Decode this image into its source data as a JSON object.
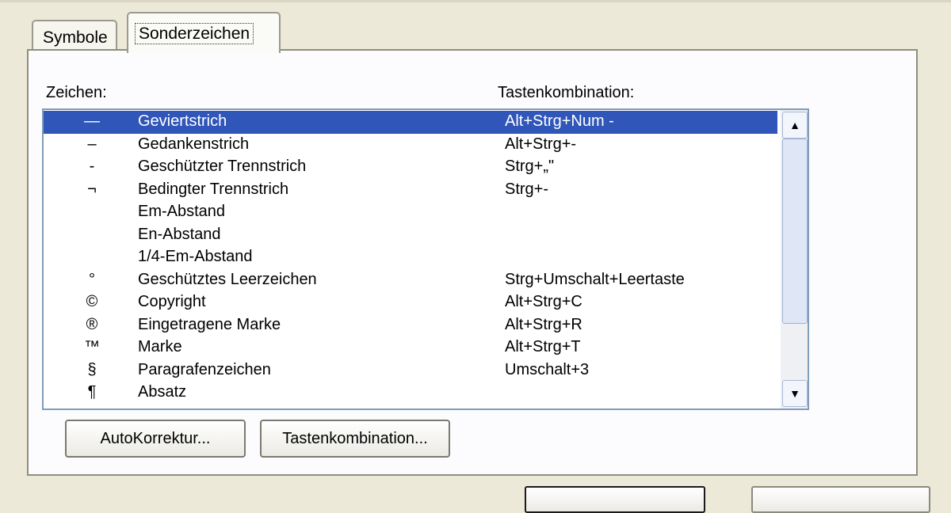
{
  "tabs": [
    {
      "label": "Symbole",
      "active": false
    },
    {
      "label": "Sonderzeichen",
      "active": true
    }
  ],
  "columns": {
    "characters": "Zeichen:",
    "shortcut": "Tastenkombination:"
  },
  "rows": [
    {
      "symbol": "—",
      "name": "Geviertstrich",
      "shortcut": "Alt+Strg+Num -",
      "selected": true
    },
    {
      "symbol": "–",
      "name": "Gedankenstrich",
      "shortcut": "Alt+Strg+-"
    },
    {
      "symbol": "-",
      "name": "Geschützter Trennstrich",
      "shortcut": "Strg+„\""
    },
    {
      "symbol": "¬",
      "name": "Bedingter Trennstrich",
      "shortcut": "Strg+-"
    },
    {
      "symbol": "",
      "name": "Em-Abstand",
      "shortcut": ""
    },
    {
      "symbol": "",
      "name": "En-Abstand",
      "shortcut": ""
    },
    {
      "symbol": "",
      "name": "1/4-Em-Abstand",
      "shortcut": ""
    },
    {
      "symbol": "°",
      "name": "Geschütztes Leerzeichen",
      "shortcut": "Strg+Umschalt+Leertaste"
    },
    {
      "symbol": "©",
      "name": "Copyright",
      "shortcut": "Alt+Strg+C"
    },
    {
      "symbol": "®",
      "name": "Eingetragene Marke",
      "shortcut": "Alt+Strg+R"
    },
    {
      "symbol": "™",
      "name": "Marke",
      "shortcut": "Alt+Strg+T"
    },
    {
      "symbol": "§",
      "name": "Paragrafenzeichen",
      "shortcut": "Umschalt+3"
    },
    {
      "symbol": "¶",
      "name": "Absatz",
      "shortcut": ""
    }
  ],
  "scrollbar": {
    "up_icon": "scroll-up-arrow-icon",
    "down_icon": "scroll-down-arrow-icon",
    "up_glyph": "▲",
    "down_glyph": "▼"
  },
  "buttons": {
    "autokorrektur": "AutoKorrektur...",
    "tastenkombination": "Tastenkombination..."
  },
  "colors": {
    "selection": "#2f56b8",
    "dialog_bg": "#ece9d8",
    "list_border": "#7f9db9"
  }
}
